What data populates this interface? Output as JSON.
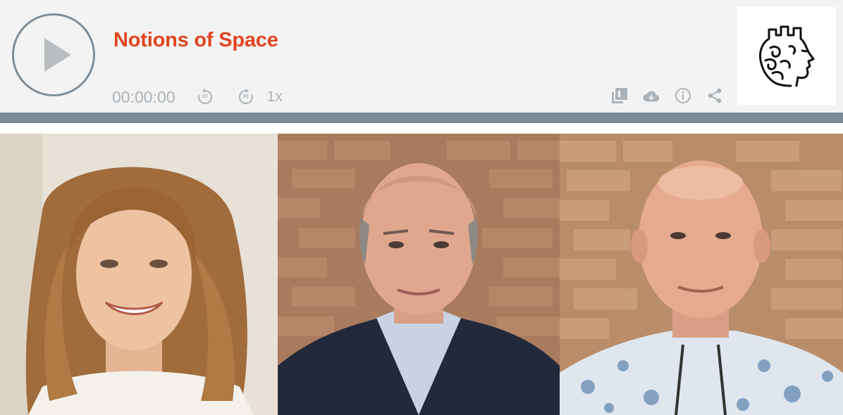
{
  "player": {
    "title": "Notions of Space",
    "time": "00:00:00",
    "skip_back_seconds": "10",
    "skip_forward_seconds": "30",
    "speed": "1x",
    "icons": [
      "play-icon",
      "skip-back-10-icon",
      "skip-forward-30-icon",
      "playlist-icon",
      "download-icon",
      "info-icon",
      "share-icon"
    ],
    "colors": {
      "title": "#e0451f",
      "controls": "#aab2b8",
      "ring": "#7e8e99",
      "bar": "#7c8c96",
      "background": "#f3f3f3"
    }
  },
  "logo": {
    "name": "greek-head-logo"
  },
  "photos": [
    {
      "name": "portrait-woman"
    },
    {
      "name": "portrait-man-dark-jacket"
    },
    {
      "name": "portrait-man-floral-shirt"
    }
  ]
}
